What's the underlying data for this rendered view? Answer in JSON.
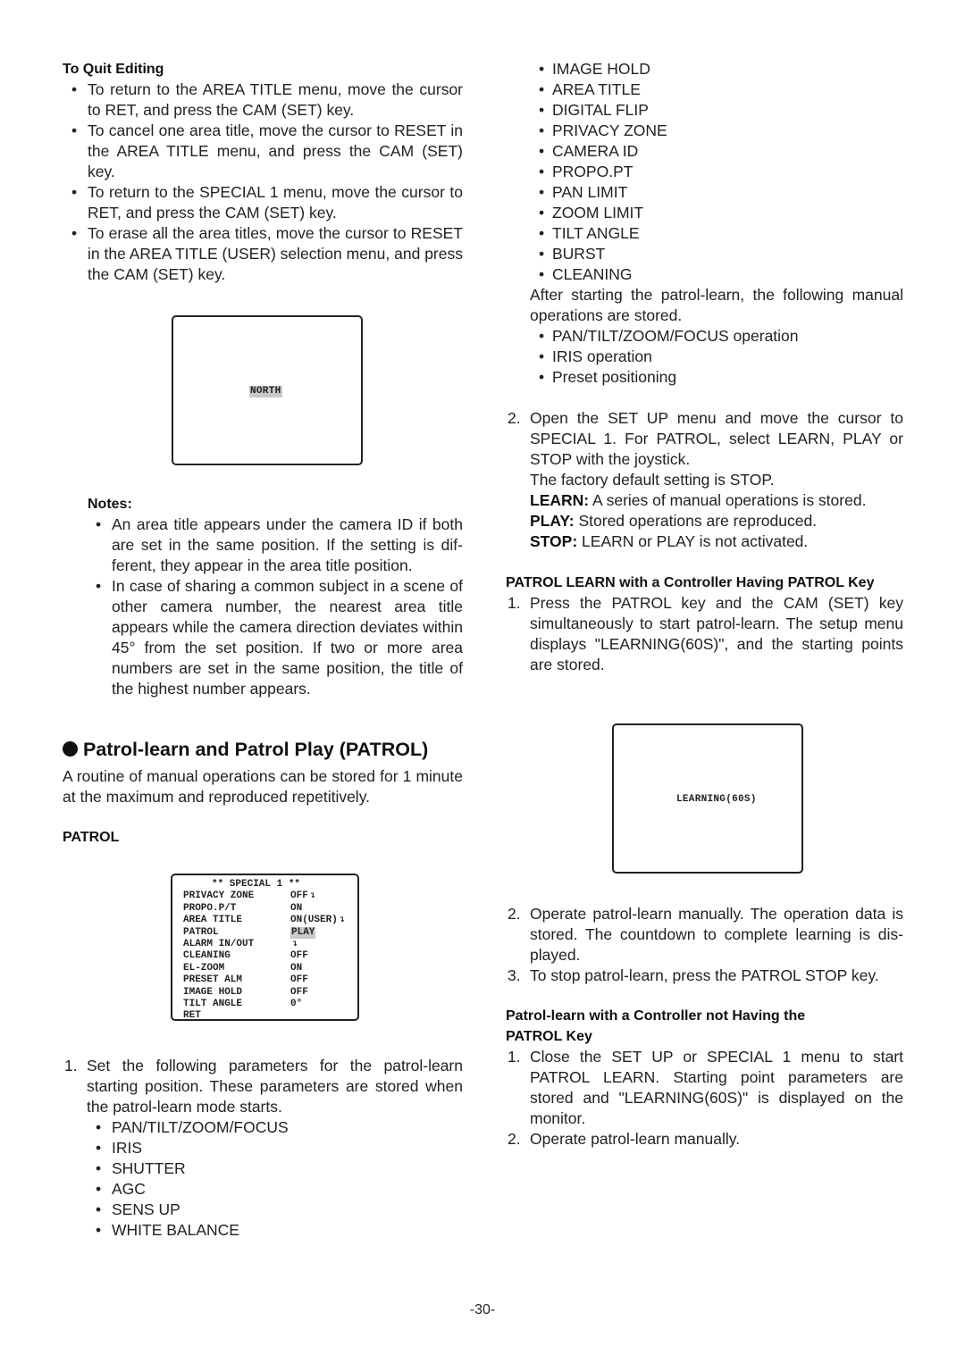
{
  "left": {
    "quit_editing": {
      "heading": "To Quit Editing",
      "bullets": [
        "To return to the AREA TITLE menu, move the cursor to RET, and press the CAM (SET) key.",
        "To cancel one area title, move the cursor to RESET in the AREA TITLE menu, and press the CAM (SET) key.",
        "To return to the SPECIAL 1 menu, move the cursor to RET, and press the CAM (SET) key.",
        "To erase all the area titles, move the cursor to RESET in the AREA TITLE (USER) selection menu, and press the CAM (SET) key."
      ]
    },
    "monitor_north": {
      "text": "NORTH"
    },
    "notes": {
      "heading": "Notes:",
      "bullets": [
        "An area title appears under the camera ID if both are set in the same position. If the setting is dif-ferent, they appear in the area title position.",
        "In case of sharing a common subject in a scene of other camera number, the nearest area title appears while the camera direction deviates within 45° from the set position. If two or more area numbers are set in the same position, the title of the highest number appears."
      ]
    },
    "section": {
      "title": "Patrol-learn and Patrol Play (PATROL)",
      "intro": "A routine of manual operations can be stored for 1 minute at the maximum and reproduced repetitively."
    },
    "patrol_heading": "PATROL",
    "special_menu": {
      "title": "** SPECIAL 1 **",
      "rows": [
        {
          "label": "PRIVACY ZONE",
          "value": "OFF",
          "arrow": true,
          "highlight": false
        },
        {
          "label": "PROPO.P/T",
          "value": "ON",
          "arrow": false,
          "highlight": false
        },
        {
          "label": "AREA TITLE",
          "value": "ON(USER)",
          "arrow": true,
          "highlight": false
        },
        {
          "label": "PATROL",
          "value": "PLAY",
          "arrow": false,
          "highlight": true
        },
        {
          "label": "ALARM IN/OUT",
          "value": "",
          "arrow": true,
          "highlight": false
        },
        {
          "label": "CLEANING",
          "value": "OFF",
          "arrow": false,
          "highlight": false
        },
        {
          "label": "EL-ZOOM",
          "value": "ON",
          "arrow": false,
          "highlight": false
        },
        {
          "label": "PRESET ALM",
          "value": "OFF",
          "arrow": false,
          "highlight": false
        },
        {
          "label": "IMAGE HOLD",
          "value": "OFF",
          "arrow": false,
          "highlight": false
        },
        {
          "label": "TILT ANGLE",
          "value": "0°",
          "arrow": false,
          "highlight": false
        },
        {
          "label": "RET",
          "value": "",
          "arrow": false,
          "highlight": false
        }
      ],
      "arrow_glyph": "↴"
    },
    "step1": {
      "number": "1.",
      "text": "Set the following parameters for the patrol-learn starting position. These parameters are stored when the patrol-learn mode starts.",
      "params": [
        "PAN/TILT/ZOOM/FOCUS",
        "IRIS",
        "SHUTTER",
        "AGC",
        "SENS UP",
        "WHITE BALANCE"
      ]
    }
  },
  "right": {
    "params_cont": [
      "IMAGE HOLD",
      "AREA TITLE",
      "DIGITAL FLIP",
      "PRIVACY ZONE",
      "CAMERA ID",
      "PROPO.PT",
      "PAN LIMIT",
      "ZOOM LIMIT",
      "TILT ANGLE",
      "BURST",
      "CLEANING"
    ],
    "after_text": "After starting the patrol-learn, the following manual operations are stored.",
    "manual_ops": [
      "PAN/TILT/ZOOM/FOCUS operation",
      "IRIS operation",
      "Preset positioning"
    ],
    "step2": {
      "number": "2.",
      "text": "Open the SET UP menu and move the cursor to SPECIAL 1. For PATROL, select LEARN, PLAY or STOP with the joystick.",
      "default_text": "The factory default setting is STOP.",
      "defs": [
        {
          "term": "LEARN:",
          "desc": "A series of manual operations is stored."
        },
        {
          "term": "PLAY:",
          "desc": "Stored operations are reproduced."
        },
        {
          "term": "STOP:",
          "desc": "LEARN or PLAY is not activated."
        }
      ]
    },
    "with_key": {
      "heading": "PATROL LEARN with a Controller Having PATROL Key",
      "steps": [
        {
          "number": "1.",
          "text": "Press the PATROL key and the CAM (SET) key simultaneously to start patrol-learn. The setup menu displays \"LEARNING(60S)\", and the starting points are stored."
        }
      ],
      "monitor_text": "LEARNING(60S)",
      "steps_after": [
        {
          "number": "2.",
          "text": "Operate patrol-learn manually. The operation data is stored. The countdown to complete learning is dis-played."
        },
        {
          "number": "3.",
          "text": "To stop patrol-learn, press the PATROL STOP key."
        }
      ]
    },
    "without_key": {
      "heading": "Patrol-learn with a Controller not Having the PATROL Key",
      "steps": [
        {
          "number": "1.",
          "text": "Close the SET UP or SPECIAL 1 menu to start PATROL LEARN. Starting point parameters are stored and \"LEARNING(60S)\" is displayed on the monitor."
        },
        {
          "number": "2.",
          "text": "Operate patrol-learn manually."
        }
      ]
    }
  },
  "page_number": "-30-"
}
